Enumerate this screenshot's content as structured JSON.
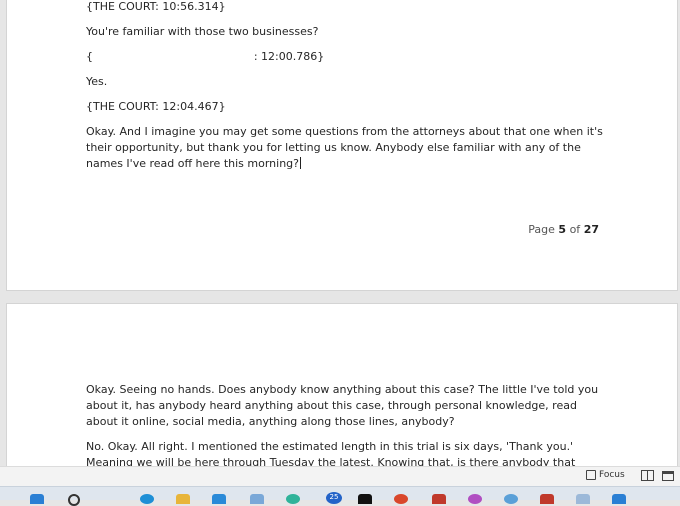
{
  "document": {
    "page1": {
      "paragraphs": [
        "{THE COURT: 10:56.314}",
        "You're familiar with those two businesses?",
        "{                                              : 12:00.786}",
        "Yes.",
        "{THE COURT: 12:04.467}",
        "Okay. And I imagine you may get some questions from the attorneys about that one when it's their opportunity, but thank you for letting us know. Anybody else familiar with any of the names I've read off here this morning?"
      ]
    },
    "page_indicator": {
      "prefix": "Page",
      "current": "5",
      "of": "of",
      "total": "27"
    },
    "page2": {
      "paragraphs": [
        "Okay. Seeing no hands. Does anybody know anything about this case? The little I've told you about it, has anybody heard anything about this case, through personal knowledge, read about it online, social media, anything along those lines, anybody?",
        "No. Okay. All right. I mentioned the estimated length in this trial is six days, 'Thank you.' Meaning we will be here through Tuesday the latest. Knowing that, is there anybody that absolutely cannot be with us"
      ]
    }
  },
  "statusbar": {
    "focus_label": "Focus"
  },
  "taskbar": {
    "badge_count": "25"
  }
}
